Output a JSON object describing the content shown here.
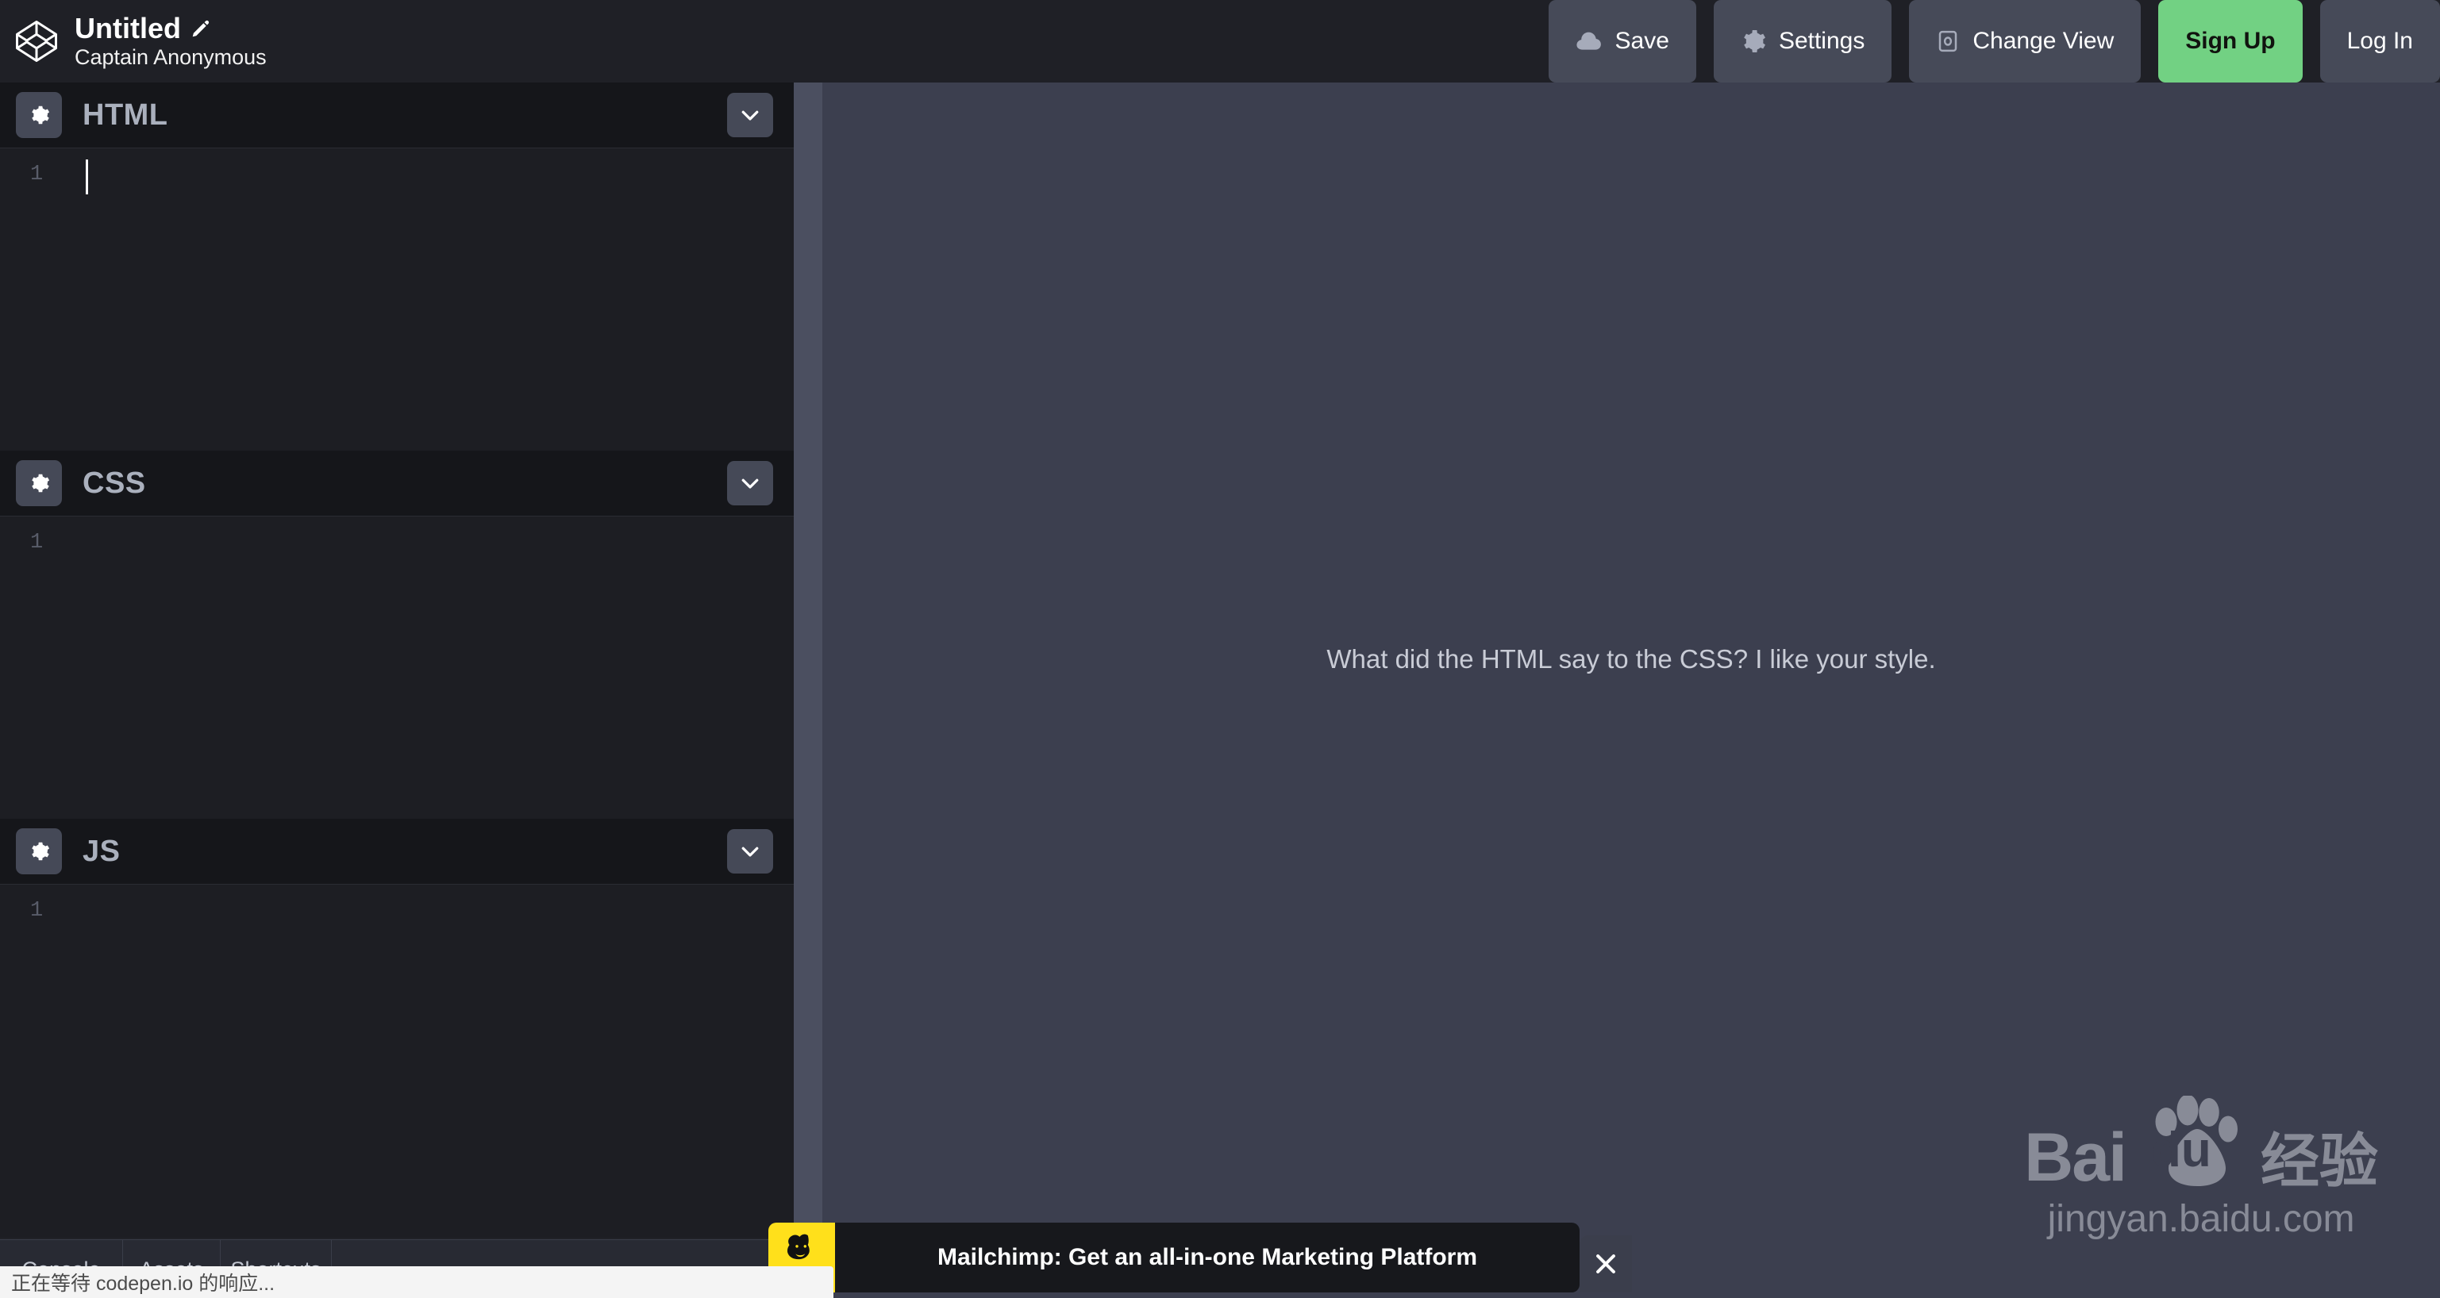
{
  "header": {
    "logo_icon": "codepen-logo-icon",
    "pen_title": "Untitled",
    "edit_icon": "pencil-icon",
    "author": "Captain Anonymous",
    "buttons": [
      {
        "label": "Save",
        "icon": "cloud-icon",
        "style": "default"
      },
      {
        "label": "Settings",
        "icon": "gear-icon",
        "style": "default"
      },
      {
        "label": "Change View",
        "icon": "screen-icon",
        "style": "default"
      },
      {
        "label": "Sign Up",
        "icon": "",
        "style": "primary"
      },
      {
        "label": "Log In",
        "icon": "",
        "style": "default"
      }
    ]
  },
  "editors": [
    {
      "label": "HTML",
      "settings_icon": "gear-icon",
      "collapse_icon": "chevron-down-icon",
      "line_number": "1",
      "code": ""
    },
    {
      "label": "CSS",
      "settings_icon": "gear-icon",
      "collapse_icon": "chevron-down-icon",
      "line_number": "1",
      "code": ""
    },
    {
      "label": "JS",
      "settings_icon": "gear-icon",
      "collapse_icon": "chevron-down-icon",
      "line_number": "1",
      "code": ""
    }
  ],
  "bottom_toolbar": {
    "items": [
      {
        "label": "Console"
      },
      {
        "label": "Assets"
      },
      {
        "label": "Shortcuts"
      }
    ]
  },
  "preview": {
    "joke_text": "What did the HTML say to the CSS? I like your style."
  },
  "watermark": {
    "brand_latin": "Bai",
    "brand_latin_2": "du",
    "brand_cn": "经验",
    "url": "jingyan.baidu.com",
    "paw_icon": "paw-print-icon"
  },
  "ad": {
    "logo_icon": "mailchimp-icon",
    "logo_word": "chimp",
    "text": "Mailchimp: Get an all-in-one Marketing Platform",
    "close_icon": "close-icon"
  },
  "browser": {
    "status_text": "正在等待 codepen.io 的响应..."
  },
  "colors": {
    "header_bg": "#1f2026",
    "editor_bg": "#1d1e23",
    "panel_head_bg": "#15161a",
    "preview_bg": "#3c3f4f",
    "accent_green": "#72d183",
    "button_slate": "#464a58"
  }
}
